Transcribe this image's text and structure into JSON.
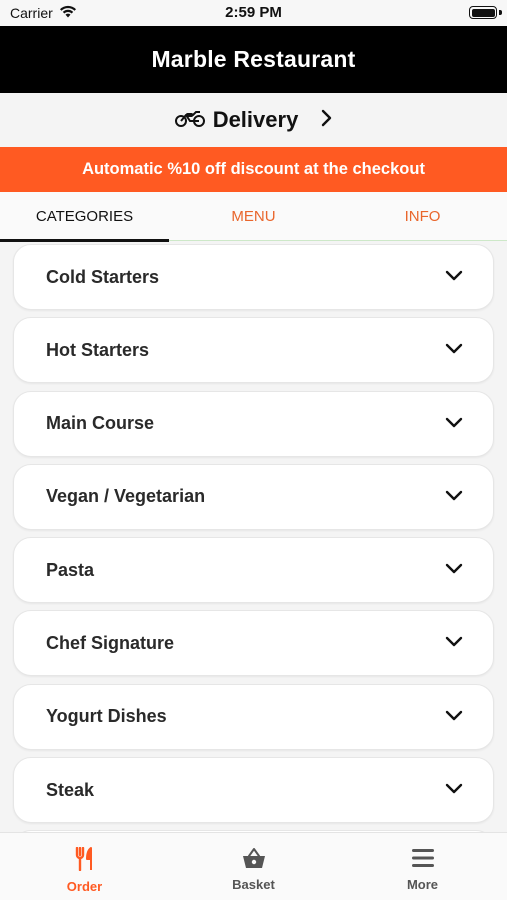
{
  "status_bar": {
    "carrier": "Carrier",
    "time": "2:59 PM"
  },
  "header": {
    "title": "Marble Restaurant"
  },
  "delivery": {
    "label": "Delivery",
    "icon": "motorcycle-icon"
  },
  "promo": {
    "text": "Automatic %10 off discount at the checkout",
    "color": "#ff5a22"
  },
  "tabs": [
    {
      "label": "CATEGORIES",
      "active": true
    },
    {
      "label": "MENU",
      "active": false
    },
    {
      "label": "INFO",
      "active": false
    }
  ],
  "categories": [
    {
      "name": "Cold Starters"
    },
    {
      "name": "Hot Starters"
    },
    {
      "name": "Main Course"
    },
    {
      "name": "Vegan / Vegetarian"
    },
    {
      "name": "Pasta"
    },
    {
      "name": "Chef Signature"
    },
    {
      "name": "Yogurt Dishes"
    },
    {
      "name": "Steak"
    }
  ],
  "bottom_nav": [
    {
      "label": "Order",
      "icon": "fork-knife-icon",
      "active": true
    },
    {
      "label": "Basket",
      "icon": "basket-icon",
      "active": false
    },
    {
      "label": "More",
      "icon": "menu-icon",
      "active": false
    }
  ],
  "colors": {
    "accent": "#ff5a22",
    "tab_inactive": "#e9662c",
    "header_bg": "#000000"
  }
}
